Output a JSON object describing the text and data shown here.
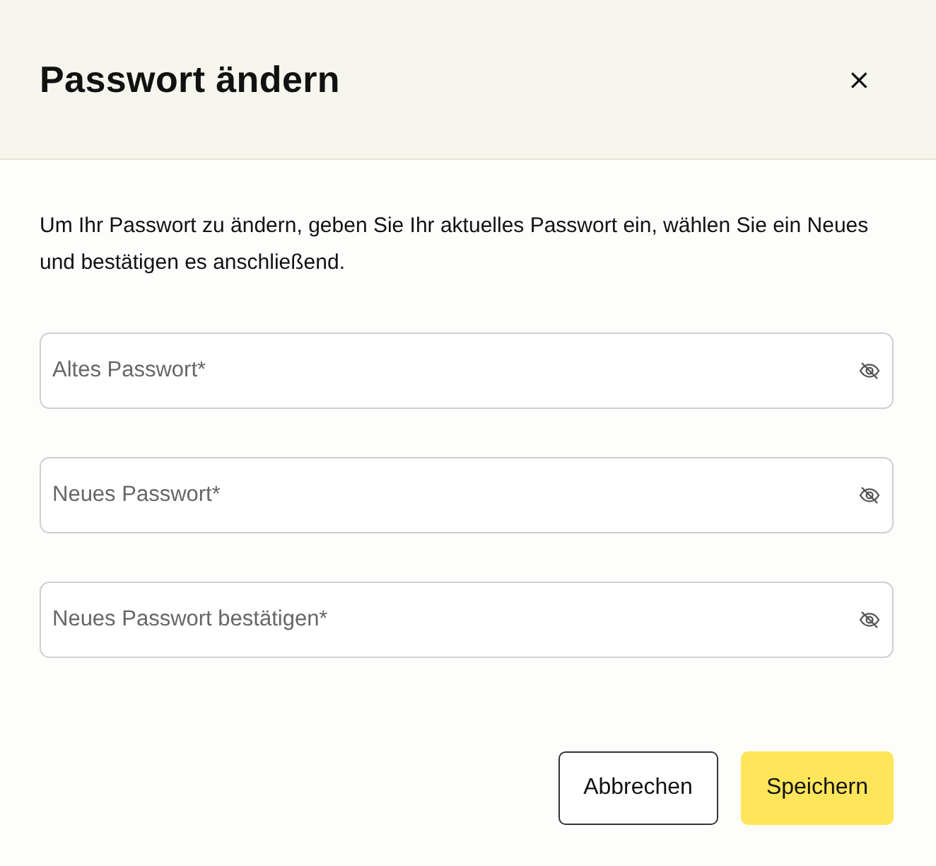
{
  "dialog": {
    "title": "Passwort ändern",
    "close": "×"
  },
  "description": "Um Ihr Passwort zu ändern, geben Sie Ihr aktuelles Passwort ein, wählen Sie ein Neues und bestätigen es anschließend.",
  "fields": [
    {
      "placeholder": "Altes Passwort*"
    },
    {
      "placeholder": "Neues Passwort*"
    },
    {
      "placeholder": "Neues Passwort bestätigen*"
    }
  ],
  "buttons": [
    {
      "label": "Abbrechen",
      "kind": "secondary"
    },
    {
      "label": "Speichern",
      "kind": "primary"
    }
  ]
}
